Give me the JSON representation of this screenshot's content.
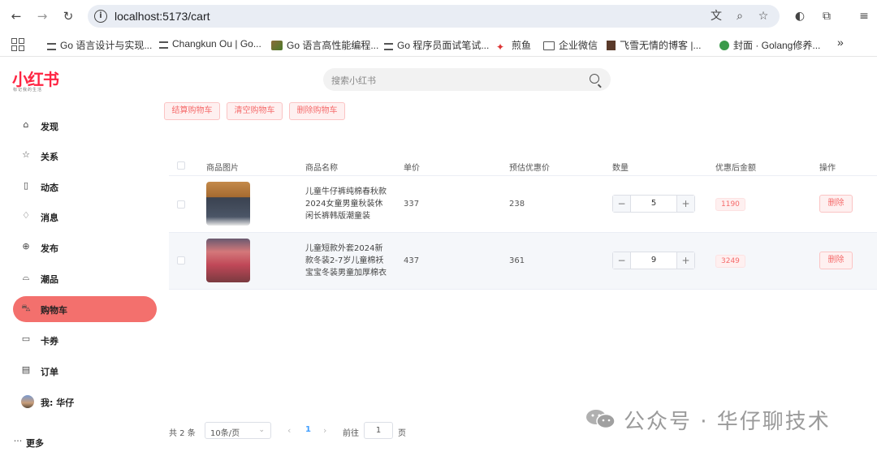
{
  "browser": {
    "url": "localhost:5173/cart",
    "bookmarks": [
      "Go 语言设计与实现...",
      "Changkun Ou | Go...",
      "Go 语言高性能编程...",
      "Go 程序员面试笔试...",
      "煎鱼",
      "企业微信",
      "飞雪无情的博客 |...",
      "封面 · Golang修养..."
    ],
    "more": "»"
  },
  "app": {
    "logo": "小红书",
    "logo_sub": "标记我的生活"
  },
  "sidebar": {
    "items": [
      {
        "label": "发现",
        "icon": "home-icon"
      },
      {
        "label": "关系",
        "icon": "star-icon"
      },
      {
        "label": "动态",
        "icon": "book-icon"
      },
      {
        "label": "消息",
        "icon": "bell-icon"
      },
      {
        "label": "发布",
        "icon": "plus-circle-icon"
      },
      {
        "label": "潮品",
        "icon": "bag-icon"
      },
      {
        "label": "购物车",
        "icon": "cart-icon",
        "active": true
      },
      {
        "label": "卡券",
        "icon": "card-icon"
      },
      {
        "label": "订单",
        "icon": "document-icon"
      }
    ],
    "user": "我: 华仔",
    "more": "更多"
  },
  "search": {
    "placeholder": "搜索小红书"
  },
  "actions": {
    "checkout": "结算购物车",
    "clear": "清空购物车",
    "delete": "删除购物车"
  },
  "table": {
    "headers": [
      "商品图片",
      "商品名称",
      "单价",
      "预估优惠价",
      "数量",
      "优惠后金额",
      "操作"
    ],
    "rows": [
      {
        "name": "儿童牛仔裤纯棉春秋款2024女童男童秋装休闲长裤韩版潮童装",
        "price": "337",
        "discount_price": "238",
        "quantity": "5",
        "total": "1190",
        "delete": "删除"
      },
      {
        "name": "儿童短款外套2024新款冬装2-7岁儿童棉袄宝宝冬装男童加厚棉衣",
        "price": "437",
        "discount_price": "361",
        "quantity": "9",
        "total": "3249",
        "delete": "删除"
      }
    ]
  },
  "pagination": {
    "total": "共 2 条",
    "page_size": "10条/页",
    "current": "1",
    "goto_label": "前往",
    "goto_value": "1",
    "page_unit": "页"
  },
  "watermark": "公众号 · 华仔聊技术",
  "colors": {
    "accent": "#ff2442",
    "active_nav": "#f3706d",
    "danger": "#f56c6c",
    "primary": "#409eff"
  }
}
